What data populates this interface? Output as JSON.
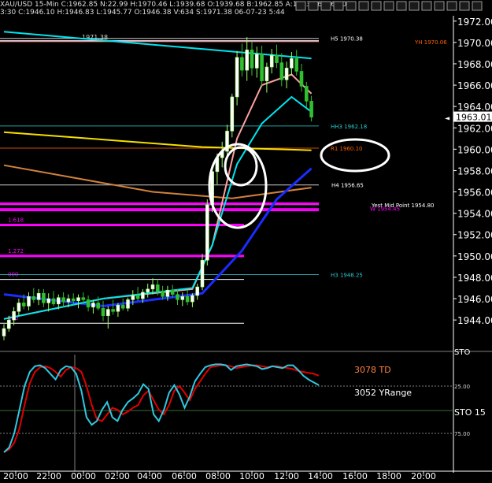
{
  "header": {
    "symbol": "XAU/USD 15-Min",
    "text": "XAU/USD 15-Min C:1962.85 N:22.99 H:1970.46 L:1939.68 O:1939.68 B:1962.85 A:1963.16 V:64.0K",
    "text2": "3:30 C:1946.10 H:1946.83 L:1945.77 O:1946.38 V:634 S:1971.38 06-07-23 5:44",
    "toolbar_icons": [
      "circle-icon",
      "copy-icon",
      "print-icon",
      "close-icon",
      "zoom-icon",
      "chart-icon",
      "arrow-icon",
      "settings-icon",
      "note-icon",
      "grid-icon",
      "list-icon",
      "bars-icon",
      "x-icon",
      "arrow-left-icon",
      "arrow-right-icon"
    ]
  },
  "colors": {
    "background": "#000000",
    "axis": "#ffffff",
    "price_line_cyan": "#00e5ee",
    "ma_yellow": "#f5e000",
    "ma_orange": "#d2823c",
    "ma_blue": "#1a2cff",
    "ma_pink": "#ffa0a0",
    "fib_magenta": "#ff00ff",
    "stoch_red": "#e00000",
    "stoch_cyan": "#30c8e0",
    "annotation_white": "#ffffff",
    "annotation_orange": "#ff8040",
    "level_label_orange": "#ff6000",
    "level_label_cyan": "#30c8d0"
  },
  "chart_data": [
    {
      "type": "candlestick",
      "pane": "price",
      "x_ticks": [
        "20:00",
        "22:00",
        "00:00",
        "02:00",
        "04:00",
        "06:00",
        "08:00",
        "10:00",
        "12:00",
        "14:00",
        "16:00",
        "18:00",
        "20:00"
      ],
      "y_ticks": [
        1944.0,
        1946.0,
        1948.0,
        1950.0,
        1952.0,
        1954.0,
        1956.0,
        1958.0,
        1960.0,
        1962.0,
        1964.0,
        1966.0,
        1968.0,
        1970.0,
        1972.0
      ],
      "ylim": [
        1941.5,
        1972.5
      ],
      "current_price_label": "1963.01",
      "top_label": "1971.38",
      "ohlc": [
        [
          1942.5,
          1943.6,
          1942.1,
          1943.2
        ],
        [
          1943.2,
          1944.4,
          1942.9,
          1944.0
        ],
        [
          1944.0,
          1945.2,
          1943.5,
          1944.8
        ],
        [
          1944.8,
          1946.0,
          1944.4,
          1945.6
        ],
        [
          1945.6,
          1946.4,
          1945.0,
          1945.3
        ],
        [
          1945.3,
          1946.6,
          1944.9,
          1946.2
        ],
        [
          1946.2,
          1947.0,
          1945.6,
          1945.9
        ],
        [
          1945.9,
          1946.9,
          1945.4,
          1946.5
        ],
        [
          1946.5,
          1946.9,
          1945.2,
          1945.6
        ],
        [
          1945.6,
          1946.5,
          1944.8,
          1946.0
        ],
        [
          1946.0,
          1946.7,
          1945.3,
          1945.5
        ],
        [
          1945.5,
          1946.4,
          1945.0,
          1946.1
        ],
        [
          1946.1,
          1946.6,
          1945.2,
          1945.7
        ],
        [
          1945.7,
          1946.4,
          1945.2,
          1946.0
        ],
        [
          1946.0,
          1946.5,
          1945.4,
          1945.8
        ],
        [
          1945.8,
          1946.4,
          1945.1,
          1946.1
        ],
        [
          1946.1,
          1946.6,
          1945.5,
          1945.9
        ],
        [
          1945.9,
          1946.3,
          1944.8,
          1945.2
        ],
        [
          1945.2,
          1945.9,
          1944.6,
          1945.6
        ],
        [
          1945.6,
          1946.2,
          1944.9,
          1945.1
        ],
        [
          1945.1,
          1945.8,
          1943.9,
          1944.4
        ],
        [
          1944.4,
          1945.3,
          1943.2,
          1945.0
        ],
        [
          1945.0,
          1945.9,
          1944.5,
          1944.8
        ],
        [
          1944.8,
          1945.6,
          1944.3,
          1945.4
        ],
        [
          1945.4,
          1946.0,
          1944.9,
          1945.1
        ],
        [
          1945.1,
          1946.1,
          1944.8,
          1945.9
        ],
        [
          1945.9,
          1946.8,
          1945.4,
          1946.3
        ],
        [
          1946.3,
          1947.1,
          1945.8,
          1946.0
        ],
        [
          1946.0,
          1946.9,
          1945.6,
          1946.6
        ],
        [
          1946.6,
          1947.4,
          1946.1,
          1946.9
        ],
        [
          1946.9,
          1947.9,
          1946.4,
          1947.3
        ],
        [
          1947.3,
          1947.8,
          1946.3,
          1946.7
        ],
        [
          1946.7,
          1947.2,
          1945.9,
          1946.2
        ],
        [
          1946.2,
          1947.2,
          1945.8,
          1946.8
        ],
        [
          1946.8,
          1947.3,
          1946.1,
          1946.4
        ],
        [
          1946.4,
          1946.9,
          1945.4,
          1945.9
        ],
        [
          1945.9,
          1946.6,
          1945.3,
          1946.2
        ],
        [
          1946.2,
          1946.8,
          1945.4,
          1945.7
        ],
        [
          1945.7,
          1946.5,
          1945.2,
          1946.3
        ],
        [
          1946.3,
          1947.4,
          1945.9,
          1947.1
        ],
        [
          1947.1,
          1950.2,
          1946.8,
          1949.6
        ],
        [
          1949.6,
          1955.3,
          1949.1,
          1954.8
        ],
        [
          1954.8,
          1958.4,
          1954.1,
          1957.9
        ],
        [
          1957.9,
          1959.6,
          1956.7,
          1959.2
        ],
        [
          1959.2,
          1960.7,
          1958.3,
          1959.8
        ],
        [
          1959.8,
          1962.3,
          1959.0,
          1961.7
        ],
        [
          1961.7,
          1965.2,
          1961.1,
          1964.9
        ],
        [
          1964.9,
          1969.2,
          1964.1,
          1968.6
        ],
        [
          1968.6,
          1969.9,
          1966.8,
          1967.4
        ],
        [
          1967.4,
          1970.5,
          1966.4,
          1969.3
        ],
        [
          1969.3,
          1970.1,
          1966.9,
          1967.6
        ],
        [
          1967.6,
          1969.6,
          1966.7,
          1968.9
        ],
        [
          1968.9,
          1969.7,
          1965.8,
          1966.4
        ],
        [
          1966.4,
          1968.1,
          1965.3,
          1967.7
        ],
        [
          1967.7,
          1969.4,
          1967.1,
          1968.8
        ],
        [
          1968.8,
          1969.8,
          1967.6,
          1968.1
        ],
        [
          1968.1,
          1969.0,
          1965.9,
          1966.5
        ],
        [
          1966.5,
          1968.2,
          1965.7,
          1967.6
        ],
        [
          1967.6,
          1969.1,
          1966.9,
          1968.5
        ],
        [
          1968.5,
          1969.3,
          1966.9,
          1967.3
        ],
        [
          1967.3,
          1968.0,
          1965.4,
          1965.9
        ],
        [
          1965.9,
          1966.3,
          1963.9,
          1964.5
        ],
        [
          1964.5,
          1965.0,
          1962.6,
          1963.0
        ]
      ],
      "moving_averages": [
        {
          "color_key": "price_line_cyan",
          "x": [
            0,
            62
          ],
          "y": [
            1971.0,
            1968.5
          ]
        },
        {
          "color_key": "ma_yellow",
          "x": [
            0,
            40,
            62
          ],
          "y": [
            1961.6,
            1960.2,
            1959.9
          ]
        },
        {
          "color_key": "ma_orange",
          "x": [
            0,
            30,
            46,
            62
          ],
          "y": [
            1958.5,
            1956.0,
            1955.4,
            1956.4
          ]
        },
        {
          "color_key": "ma_blue",
          "x": [
            0,
            20,
            40,
            48,
            55,
            62
          ],
          "y": [
            1946.4,
            1945.3,
            1946.5,
            1950.5,
            1955.3,
            1958.2
          ]
        },
        {
          "color_key": "ma_pink",
          "x": [
            0,
            20,
            38,
            42,
            47,
            52,
            58,
            62
          ],
          "y": [
            1944.1,
            1946.0,
            1946.9,
            1951.0,
            1961.0,
            1966.0,
            1967.0,
            1965.2
          ]
        },
        {
          "color_key": "price_line_cyan",
          "x": [
            0,
            20,
            38,
            42,
            47,
            52,
            58,
            62
          ],
          "y": [
            1944.1,
            1946.0,
            1947.0,
            1951.0,
            1958.6,
            1962.4,
            1964.9,
            1963.5
          ]
        }
      ],
      "horizontal_levels": [
        {
          "price": 1970.38,
          "label": "H5 1970.38",
          "color_key": "annotation_white"
        },
        {
          "price": 1970.06,
          "label": "YH 1970.06",
          "color_key": "level_label_orange"
        },
        {
          "price": 1962.18,
          "label": "HH3 1962.18",
          "color_key": "level_label_cyan"
        },
        {
          "price": 1960.1,
          "label": "R1 1960.10",
          "color_key": "level_label_orange"
        },
        {
          "price": 1956.65,
          "label": "H4 1956.65",
          "color_key": "annotation_white"
        },
        {
          "price": 1954.8,
          "label": "Yest Mid Point 1954.80",
          "color_key": "annotation_white"
        },
        {
          "price": 1954.45,
          "label": "W 1954.45",
          "color_key": "fib_magenta"
        },
        {
          "price": 1948.25,
          "label": "H3 1948.25",
          "color_key": "level_label_cyan"
        }
      ],
      "fib_levels": [
        {
          "price": 1952.9,
          "label": "1.618"
        },
        {
          "price": 1950.0,
          "label": "1.272"
        },
        {
          "price": 1947.8,
          "label": "000"
        },
        {
          "price": 1943.7,
          "label": "500"
        }
      ]
    },
    {
      "type": "line",
      "pane": "stochastic",
      "indicator": "STO",
      "values_label": "STO 15",
      "y_ticks": [
        25.0,
        75.0
      ],
      "ylim": [
        100,
        0
      ],
      "x_ticks": [
        "20:00",
        "22:00",
        "00:00",
        "02:00",
        "04:00",
        "06:00",
        "08:00",
        "10:00",
        "12:00",
        "14:00",
        "16:00",
        "18:00",
        "20:00"
      ],
      "series": [
        {
          "values": [
            95,
            92,
            85,
            70,
            45,
            22,
            10,
            5,
            4,
            6,
            10,
            15,
            8,
            5,
            6,
            10,
            25,
            45,
            60,
            62,
            55,
            48,
            50,
            55,
            52,
            48,
            45,
            35,
            30,
            40,
            50,
            55,
            45,
            30,
            25,
            32,
            40,
            28,
            20,
            12,
            5,
            4,
            3,
            3,
            4,
            6,
            5,
            4,
            3,
            3,
            4,
            5,
            4,
            4,
            5,
            6,
            7,
            9,
            10,
            11,
            12,
            14
          ]
        },
        {
          "values": [
            95,
            90,
            75,
            50,
            25,
            10,
            4,
            3,
            6,
            12,
            18,
            8,
            4,
            5,
            12,
            30,
            58,
            66,
            62,
            50,
            42,
            58,
            62,
            50,
            42,
            38,
            33,
            23,
            28,
            55,
            62,
            50,
            32,
            24,
            34,
            48,
            36,
            20,
            12,
            5,
            3,
            2,
            2,
            3,
            8,
            4,
            3,
            2,
            3,
            4,
            7,
            6,
            4,
            5,
            6,
            3,
            3,
            8,
            14,
            18,
            21,
            24
          ]
        }
      ],
      "annotations": [
        "3078 TD",
        "3052 YRange"
      ]
    }
  ]
}
